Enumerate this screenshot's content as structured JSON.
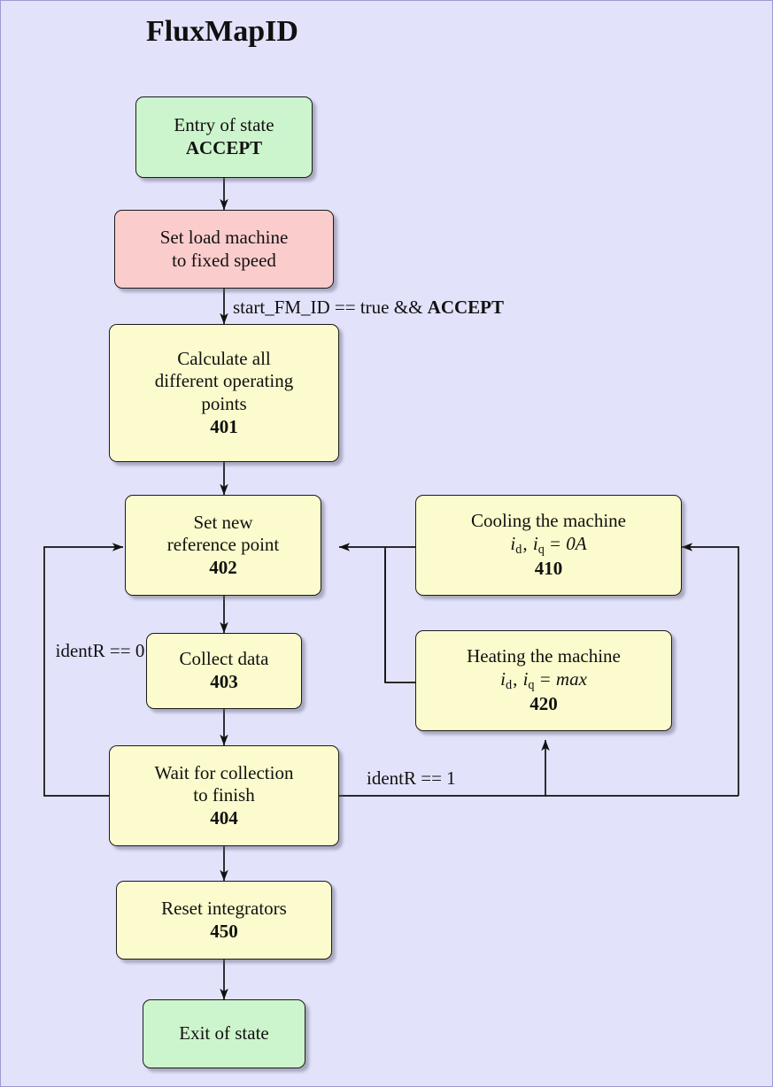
{
  "diagram": {
    "title": "FluxMapID",
    "type": "state-flowchart",
    "background_color": "#e2e2fb",
    "palette": {
      "entry_exit": "#cdf5cd",
      "action_red": "#fbcccc",
      "state_yellow": "#fbfbcd",
      "border": "#1a1a1a",
      "text": "#111111"
    }
  },
  "nodes": {
    "entry": {
      "line1": "Entry of state",
      "line2": "ACCEPT",
      "color": "#cdf5cd"
    },
    "set_load": {
      "line1": "Set load machine",
      "line2": "to fixed speed",
      "color": "#fbcccc"
    },
    "calc_points": {
      "line1": "Calculate all",
      "line2": "different operating",
      "line3": "points",
      "number": "401",
      "color": "#fbfbcd"
    },
    "set_ref": {
      "line1": "Set new",
      "line2": "reference point",
      "number": "402",
      "color": "#fbfbcd"
    },
    "collect": {
      "line1": "Collect data",
      "number": "403",
      "color": "#fbfbcd"
    },
    "wait": {
      "line1": "Wait for collection",
      "line2": "to finish",
      "number": "404",
      "color": "#fbfbcd"
    },
    "reset": {
      "line1": "Reset integrators",
      "number": "450",
      "color": "#fbfbcd"
    },
    "exit": {
      "line1": "Exit of state",
      "color": "#cdf5cd"
    },
    "cooling": {
      "line1": "Cooling the machine",
      "math_i": "i",
      "math_sub_d": "d",
      "math_comma": ", ",
      "math_i2": "i",
      "math_sub_q": "q",
      "math_eq": " = ",
      "math_value": "0A",
      "number": "410",
      "color": "#fbfbcd"
    },
    "heating": {
      "line1": "Heating the machine",
      "math_i": "i",
      "math_sub_d": "d",
      "math_comma": ", ",
      "math_i2": "i",
      "math_sub_q": "q",
      "math_eq": " = ",
      "math_value": "max",
      "number": "420",
      "color": "#fbfbcd"
    }
  },
  "edge_labels": {
    "start_condition_pre": "start_FM_ID == true && ",
    "start_condition_bold": "ACCEPT",
    "identr_zero_line1": "identR",
    "identr_zero_line2": "== 0",
    "identr_one": "identR == 1"
  },
  "edges": [
    {
      "from": "entry",
      "to": "set_load",
      "label": ""
    },
    {
      "from": "set_load",
      "to": "calc_points",
      "label": "start_FM_ID == true && ACCEPT"
    },
    {
      "from": "calc_points",
      "to": "set_ref",
      "label": ""
    },
    {
      "from": "set_ref",
      "to": "collect",
      "label": ""
    },
    {
      "from": "collect",
      "to": "wait",
      "label": ""
    },
    {
      "from": "wait",
      "to": "set_ref",
      "label": "identR == 0",
      "route": "left-loop"
    },
    {
      "from": "wait",
      "to": "heating",
      "label": "identR == 1",
      "route": "bottom-right"
    },
    {
      "from": "heating",
      "to": "cooling",
      "label": "",
      "route": "left-riser"
    },
    {
      "from": "cooling",
      "to": "set_ref",
      "label": "",
      "route": "leftward"
    },
    {
      "from": "wait",
      "to": "cooling",
      "label": "",
      "route": "far-right-loop"
    },
    {
      "from": "wait",
      "to": "reset",
      "label": ""
    },
    {
      "from": "reset",
      "to": "exit",
      "label": ""
    }
  ]
}
